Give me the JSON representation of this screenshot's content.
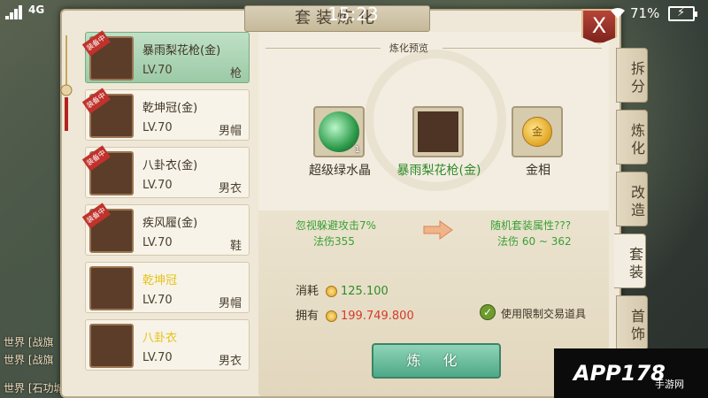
{
  "status_bar": {
    "network": "4G",
    "time": "15:23",
    "battery": "71%"
  },
  "panel": {
    "title": "套装炼化",
    "close_label": "X"
  },
  "items": [
    {
      "badge": "装备中",
      "name": "暴雨梨花枪(金)",
      "level": "LV.70",
      "type": "枪",
      "selected": true
    },
    {
      "badge": "装备中",
      "name": "乾坤冠(金)",
      "level": "LV.70",
      "type": "男帽",
      "selected": false
    },
    {
      "badge": "装备中",
      "name": "八卦衣(金)",
      "level": "LV.70",
      "type": "男衣",
      "selected": false
    },
    {
      "badge": "装备中",
      "name": "疾风履(金)",
      "level": "LV.70",
      "type": "鞋",
      "selected": false
    },
    {
      "badge": "",
      "name": "乾坤冠",
      "level": "LV.70",
      "type": "男帽",
      "selected": false
    },
    {
      "badge": "",
      "name": "八卦衣",
      "level": "LV.70",
      "type": "男衣",
      "selected": false
    }
  ],
  "tabs": [
    "拆分",
    "炼化",
    "改造",
    "套装",
    "首饰"
  ],
  "active_tab": "套装",
  "preview": {
    "label": "炼化预览",
    "slots": [
      {
        "name": "超级绿水晶",
        "qty": "1",
        "icon": "green-crystal-icon"
      },
      {
        "name": "暴雨梨花枪(金)",
        "qty": "",
        "icon": "spear-icon"
      },
      {
        "name": "金相",
        "qty": "",
        "icon": "gold-coin-icon",
        "coin_text": "金"
      }
    ],
    "current_stats": [
      "忽视躲避攻击7%",
      "法伤355"
    ],
    "result_stats": [
      "随机套装属性???",
      "法伤 60 ~ 362"
    ]
  },
  "cost": {
    "consume_label": "消耗",
    "consume_value": "125.100",
    "own_label": "拥有",
    "own_value": "199.749.800"
  },
  "checkbox_label": "使用限制交易道具",
  "refine_button": "炼 化",
  "chat_lines": [
    "世界 [战旗",
    "世界 [战旗",
    "世界 [石功城"
  ],
  "logo": {
    "text": "APP178",
    "sub": "手游网"
  },
  "colors": {
    "selected_item": "#9ccaa6",
    "green_text": "#39a036",
    "red_text": "#d63a2a",
    "refine_button": "#4ea887",
    "close_button": "#b5453a"
  }
}
